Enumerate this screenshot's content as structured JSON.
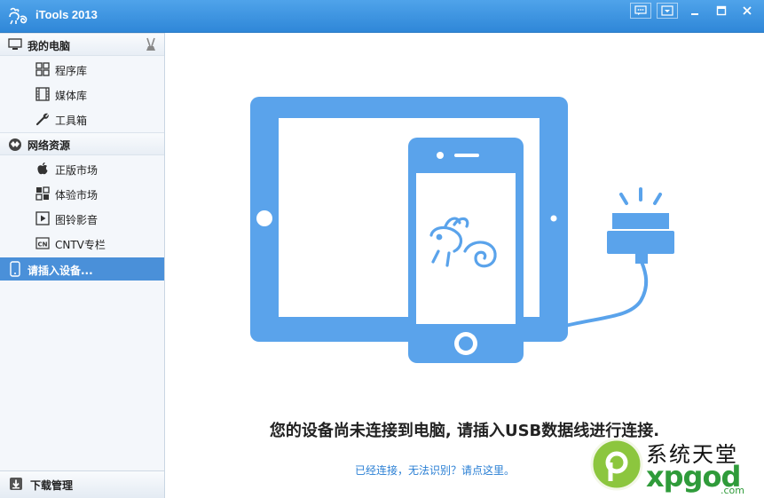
{
  "window": {
    "title": "iTools 2013"
  },
  "sidebar": {
    "my_computer": {
      "label": "我的电脑",
      "items": [
        {
          "label": "程序库",
          "icon": "grid-icon"
        },
        {
          "label": "媒体库",
          "icon": "film-icon"
        },
        {
          "label": "工具箱",
          "icon": "wrench-icon"
        }
      ]
    },
    "network": {
      "label": "网络资源",
      "items": [
        {
          "label": "正版市场",
          "icon": "apple-icon"
        },
        {
          "label": "体验市场",
          "icon": "grid-icon"
        },
        {
          "label": "图铃影音",
          "icon": "play-icon"
        },
        {
          "label": "CNTV专栏",
          "icon": "cntv-icon"
        }
      ]
    },
    "device": {
      "label": "请插入设备..."
    },
    "download": {
      "label": "下载管理"
    }
  },
  "main": {
    "message": "您的设备尚未连接到电脑, 请插入USB数据线进行连接.",
    "help_link": "已经连接，无法识别？请点这里。"
  },
  "watermark": {
    "line1": "系统天堂",
    "line2": "xpgod",
    "suffix": ".com"
  },
  "colors": {
    "accent": "#4a90d9",
    "illustration": "#5aa3eb",
    "link": "#2a7fd4",
    "watermark_green": "#2f9b3a"
  }
}
